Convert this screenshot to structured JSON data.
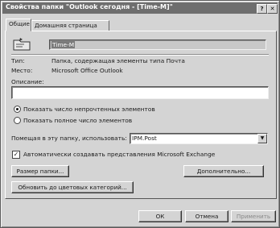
{
  "window": {
    "title": "Свойства папки \"Outlook сегодня - [Time-M]\"",
    "help_glyph": "?",
    "close_glyph": "✕"
  },
  "tabs": [
    {
      "label": "Общие",
      "active": true
    },
    {
      "label": "Домашняя страница",
      "active": false
    }
  ],
  "general": {
    "folder_icon": "folder-icon",
    "folder_name": "Time-M",
    "type_label": "Тип:",
    "type_value": "Папка, содержащая элементы типа Почта",
    "location_label": "Место:",
    "location_value": "Microsoft Office Outlook",
    "description_label": "Описание:",
    "description_value": "",
    "radio_unread": "Показать число непрочтенных элементов",
    "radio_total": "Показать полное число элементов",
    "radio_selected": "unread",
    "post_label": "Помещая в эту папку, использовать:",
    "post_value": "IPM.Post",
    "auto_exchange_label": "Автоматически создавать представления Microsoft Exchange",
    "auto_exchange_checked": true,
    "folder_size_button": "Размер папки...",
    "advanced_button": "Дополнительно...",
    "color_categories_button": "Обновить до цветовых категорий..."
  },
  "footer": {
    "ok": "ОК",
    "cancel": "Отмена",
    "apply": "Применить"
  }
}
